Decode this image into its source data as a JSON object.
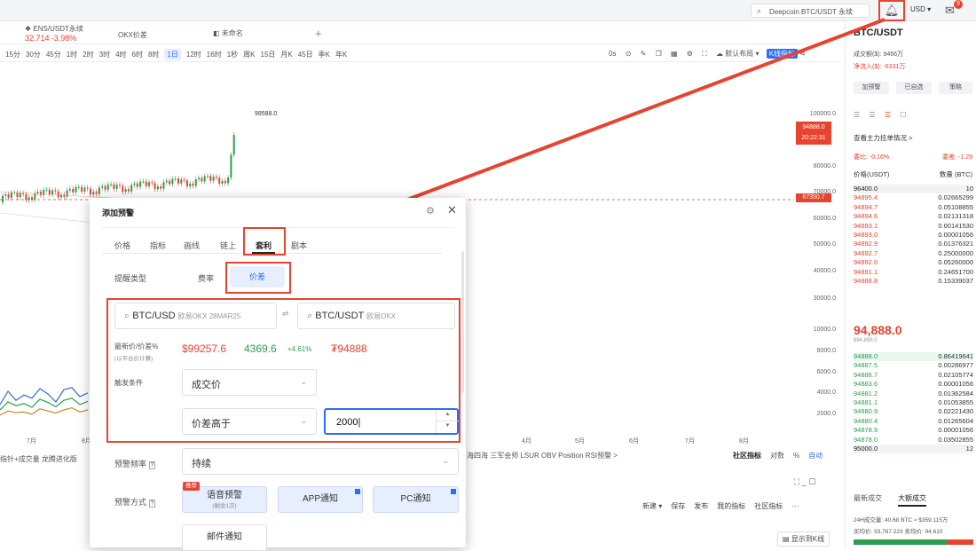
{
  "topbar": {
    "search_text": "Deepcoin BTC/USDT 永续",
    "currency": "USD",
    "mail_badge": "9"
  },
  "chart_tabs": {
    "tab1_symbol": "ENS/USDT永续",
    "tab1_price": "32.714",
    "tab1_change": "-3.98%",
    "tab2_label": "OKX价差",
    "tab3_label": "未命名",
    "add_label": "+"
  },
  "intervals": [
    "15分",
    "30分",
    "45分",
    "1时",
    "2时",
    "3时",
    "4时",
    "6时",
    "8时",
    "1日",
    "12时",
    "16时",
    "1秒",
    "周K",
    "15日",
    "月K",
    "45日",
    "季K",
    "年K"
  ],
  "active_interval": "1日",
  "chart_toolbar": {
    "ticker_label": "0s",
    "layout_label": "默认布局",
    "kline_label": "K线指标"
  },
  "chart": {
    "peak_label": "99588.0",
    "price_axis": [
      "100000.0",
      "80000.0",
      "70000.0",
      "60000.0",
      "50000.0",
      "40000.0",
      "30000.0",
      "10000.0",
      "8000.0",
      "6000.0",
      "4000.0",
      "2000.0"
    ],
    "current_price": "94888.0",
    "current_time": "20:22:31",
    "hline_price": "67350.7",
    "months": [
      "7月",
      "8月",
      "4月",
      "5月",
      "6月",
      "7月",
      "8月"
    ],
    "indicator_bar": "指针+成交量  龙腾进化版",
    "bottom_indicators": "海四海  三军会师  LSUR  OBV  Position  RSI预警  >",
    "bottom_tools": [
      "社区指标",
      "对数",
      "%",
      "自动"
    ],
    "bottom_actions": [
      "新建 ▾",
      "保存",
      "发布",
      "我的指标",
      "社区指标",
      "···"
    ],
    "show_kline": "显示到K线",
    "indicators_lines": [
      {
        "color": "#2e6fd6",
        "values": [
          40,
          65,
          48,
          58,
          52,
          70,
          60,
          45,
          68,
          72,
          55,
          62
        ]
      },
      {
        "color": "#2e9d4f",
        "values": [
          30,
          45,
          38,
          42,
          35,
          50,
          44,
          36,
          48,
          52,
          40,
          46
        ]
      },
      {
        "color": "#c78a2a",
        "values": [
          20,
          28,
          25,
          26,
          22,
          32,
          28,
          24,
          30,
          34,
          26,
          30
        ]
      }
    ]
  },
  "sidebar": {
    "symbol": "BTC/USDT",
    "vol_label": "成交额($): 9466万",
    "flow_label": "净流入($): -6331万",
    "btn1": "加预警",
    "btn2": "已自选",
    "btn3": "策略",
    "big_orders": "查看主力挂单情况 >",
    "ratio_label": "委比: -0.16%",
    "ratio_right": "委差: -1.29",
    "col_price": "价格(USDT)",
    "col_qty": "数量 (BTC)",
    "asks": [
      [
        "96400.0",
        "10"
      ],
      [
        "94895.4",
        "0.02665299"
      ],
      [
        "94894.7",
        "0.05108855"
      ],
      [
        "94894.6",
        "0.02131318"
      ],
      [
        "94893.1",
        "0.00141530"
      ],
      [
        "94893.0",
        "0.00001056"
      ],
      [
        "94892.9",
        "0.01376321"
      ],
      [
        "94892.7",
        "0.25000000"
      ],
      [
        "94892.0",
        "0.05260000"
      ],
      [
        "94891.1",
        "0.24651700"
      ],
      [
        "94888.8",
        "0.15339037"
      ]
    ],
    "last_price": "94,888.0",
    "last_price_usd": "$94,888.0",
    "bids": [
      [
        "94888.0",
        "0.86419641"
      ],
      [
        "94887.5",
        "0.00286977"
      ],
      [
        "94886.7",
        "0.02105774"
      ],
      [
        "94883.6",
        "0.00001056"
      ],
      [
        "94881.2",
        "0.01362584"
      ],
      [
        "94881.1",
        "0.01053855"
      ],
      [
        "94880.9",
        "0.02221430"
      ],
      [
        "94880.4",
        "0.01265604"
      ],
      [
        "94878.9",
        "0.00001056"
      ],
      [
        "94878.0",
        "0.03502855"
      ],
      [
        "95000.0",
        "12"
      ]
    ],
    "trades_tab1": "最新成交",
    "trades_tab2": "大额成交",
    "stats1": "24H成交量: 40.68 BTC ≈ $359.115万",
    "stats2": "买均价: 93,767.223  卖均价: 94,610"
  },
  "modal": {
    "title": "添加预警",
    "tabs": [
      "价格",
      "指标",
      "画线",
      "链上",
      "套利",
      "剧本"
    ],
    "active_tab": "套利",
    "reminder_type_label": "提醒类型",
    "type_options": [
      "费率",
      "价差"
    ],
    "type_selected": "价差",
    "pair_left_symbol": "BTC/USD",
    "pair_left_exchange": "欧易OKX 28MAR25",
    "pair_swap": "⇌",
    "pair_right_symbol": "BTC/USDT",
    "pair_right_exchange": "欧易OKX",
    "latest_label": "最新价/价差%",
    "latest_sublabel": "(以平台价计算)",
    "price_a": "$99257.6",
    "spread": "4369.6",
    "spread_pct": "+4.61%",
    "price_b": "₮94888",
    "trigger_label": "触发条件",
    "trigger_value": "成交价",
    "condition_value": "价差高于",
    "threshold_value": "2000",
    "freq_label": "预警频率",
    "freq_value": "持续",
    "method_label": "预警方式",
    "voice_badge": "推荐",
    "voice_label": "语音预警",
    "voice_sub": "(剩余1次)",
    "app_label": "APP通知",
    "pc_label": "PC通知",
    "email_label": "邮件通知"
  }
}
